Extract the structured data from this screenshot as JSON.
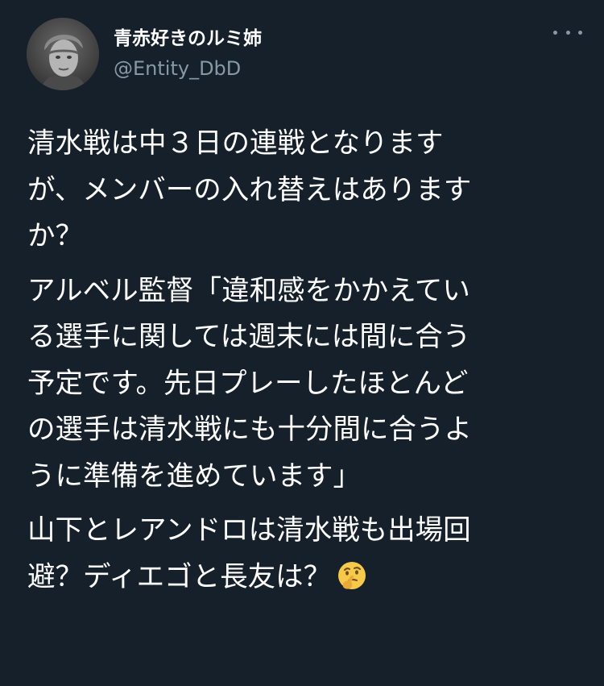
{
  "author": {
    "display_name": "青赤好きのルミ姉",
    "handle": "@Entity_DbD"
  },
  "tweet": {
    "paragraphs": [
      {
        "lines": [
          "清水戦は中３日の連戦となります",
          "が、メンバーの入れ替えはあります",
          "か？"
        ]
      },
      {
        "lines": [
          "アルベル監督「違和感をかかえてい",
          "る選手に関しては週末には間に合う",
          "予定です。先日プレーしたほとんど",
          "の選手は清水戦にも十分間に合うよ",
          "うに準備を進めています」"
        ]
      },
      {
        "lines": [
          "山下とレアンドロは清水戦も出場回",
          "避？ディエゴと長友は？"
        ],
        "trailing_emoji": "thinking-face-emoji"
      }
    ]
  },
  "icons": {
    "more": "more-options-icon",
    "avatar": "user-avatar"
  },
  "colors": {
    "background": "#15202b",
    "text": "#ffffff",
    "secondary_text": "#8899a6"
  }
}
